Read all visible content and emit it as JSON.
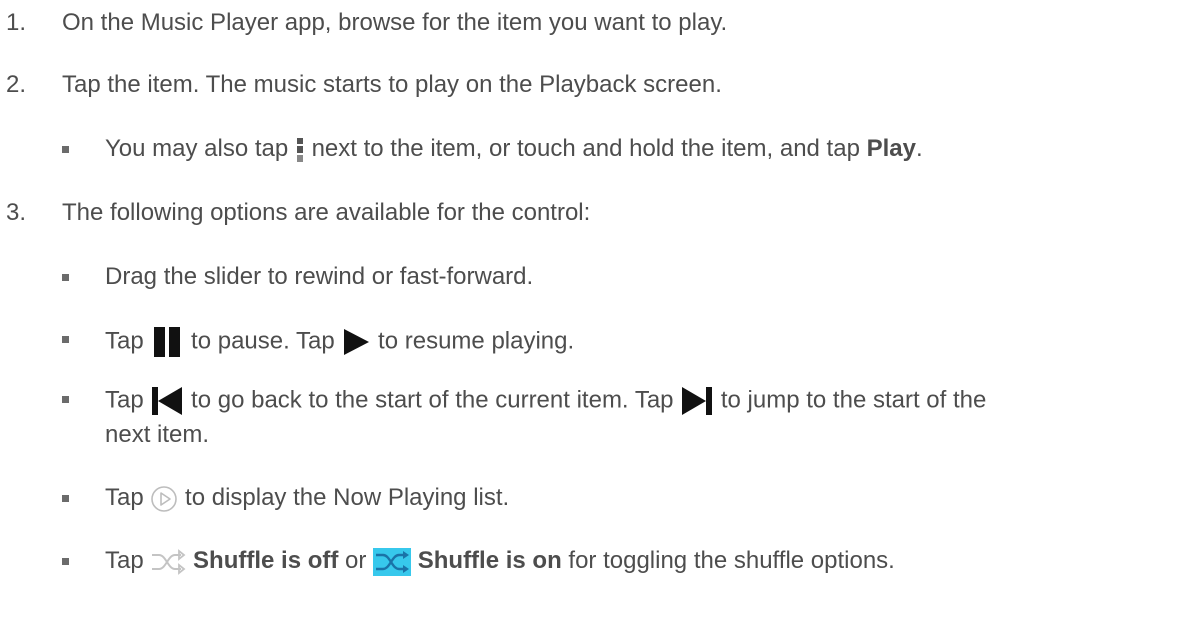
{
  "steps": [
    {
      "number": "1.",
      "text": "On the Music Player app, browse for the item you want to play."
    },
    {
      "number": "2.",
      "text": "Tap the item. The music starts to play on the Playback screen."
    },
    {
      "number": "3.",
      "text": "The following options are available for the control:"
    }
  ],
  "step2_bullets": {
    "b1": {
      "pre": "You may also tap",
      "post": " next to the item, or touch and hold the item, and tap ",
      "bold": "Play",
      "end": "."
    }
  },
  "step3_bullets": {
    "slider": {
      "text": "Drag the slider to rewind or fast-forward."
    },
    "pause": {
      "pre": "Tap",
      "mid": " to pause. Tap ",
      "post": " to resume playing."
    },
    "skip": {
      "pre": "Tap",
      "mid": " to go back to the start of the current item. Tap ",
      "post": " to jump to the start of the",
      "line2": "next item."
    },
    "now_playing": {
      "pre": "Tap",
      "post": " to display the Now Playing list."
    },
    "shuffle": {
      "pre": "Tap",
      "bold1": "Shuffle is off",
      "or": " or ",
      "bold2": "Shuffle is on",
      "post": " for toggling the shuffle options."
    }
  },
  "icons": {
    "menu": "overflow-menu-icon",
    "pause": "pause-icon",
    "play": "play-icon",
    "prev": "previous-track-icon",
    "next": "next-track-icon",
    "now_playing": "now-playing-icon",
    "shuffle_off": "shuffle-off-icon",
    "shuffle_on": "shuffle-on-icon"
  },
  "colors": {
    "text": "#4d4d4d",
    "shuffle_on_bg": "#33c3e6",
    "icon_dark": "#111111"
  }
}
